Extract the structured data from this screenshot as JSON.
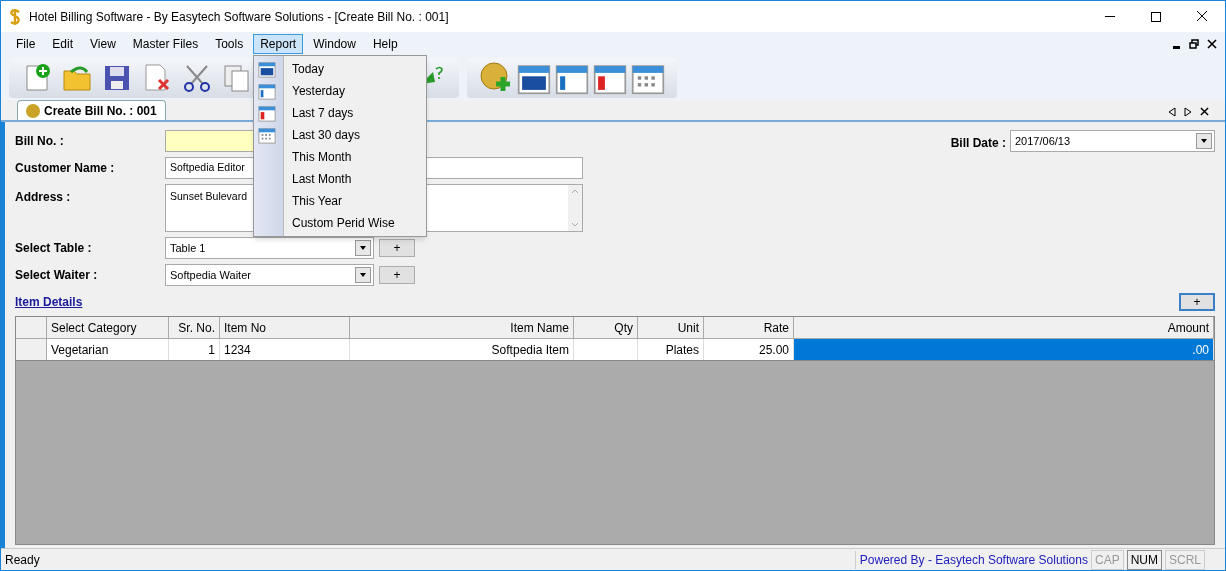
{
  "window": {
    "title": "Hotel Billing Software - By Easytech Software Solutions - [Create Bill No. : 001]"
  },
  "menu_bar": [
    {
      "label": "File",
      "selected": false
    },
    {
      "label": "Edit",
      "selected": false
    },
    {
      "label": "View",
      "selected": false
    },
    {
      "label": "Master Files",
      "selected": false
    },
    {
      "label": "Tools",
      "selected": false
    },
    {
      "label": "Report",
      "selected": true
    },
    {
      "label": "Window",
      "selected": false
    },
    {
      "label": "Help",
      "selected": false
    }
  ],
  "report_menu": [
    {
      "label": "Today"
    },
    {
      "label": "Yesterday"
    },
    {
      "label": "Last 7 days"
    },
    {
      "label": "Last 30 days"
    },
    {
      "label": "This Month"
    },
    {
      "label": "Last Month"
    },
    {
      "label": "This Year"
    },
    {
      "label": "Custom Perid Wise"
    }
  ],
  "document_tab": {
    "label": "Create Bill No. : 001",
    "selected": true
  },
  "form": {
    "bill_no_label": "Bill No. :",
    "bill_date_label": "Bill Date :",
    "bill_date": "2017/06/13",
    "customer_name_label": "Customer Name :",
    "customer_name": "Softpedia Editor",
    "address_label": "Address :",
    "address": "Sunset Bulevard",
    "table_label": "Select Table :",
    "table": "Table 1",
    "waiter_label": "Select Waiter :",
    "waiter": "Softpedia Waiter",
    "add_button": "+",
    "item_details_link": "Item Details"
  },
  "items_table": {
    "add_button": "+",
    "columns": [
      {
        "label": "Select Category"
      },
      {
        "label": "Sr. No."
      },
      {
        "label": "Item No"
      },
      {
        "label": "Item Name"
      },
      {
        "label": "Qty"
      },
      {
        "label": "Unit"
      },
      {
        "label": "Rate"
      },
      {
        "label": "Amount"
      }
    ],
    "rows": [
      {
        "cells": [
          {
            "text": "Vegetarian",
            "selected": false
          },
          {
            "text": "1",
            "selected": false
          },
          {
            "text": "1234",
            "selected": false
          },
          {
            "text": "Softpedia Item",
            "selected": false
          },
          {
            "text": "",
            "selected": false
          },
          {
            "text": "Plates",
            "selected": false
          },
          {
            "text": "25.00",
            "selected": false
          },
          {
            "text": ".00",
            "selected": true
          }
        ]
      }
    ]
  },
  "status_bar": {
    "text": "Ready",
    "powered_by": "Powered By - Easytech Software Solutions",
    "indicators": [
      {
        "label": "CAP",
        "on": false
      },
      {
        "label": "NUM",
        "on": true
      },
      {
        "label": "SCRL",
        "on": false
      }
    ]
  }
}
